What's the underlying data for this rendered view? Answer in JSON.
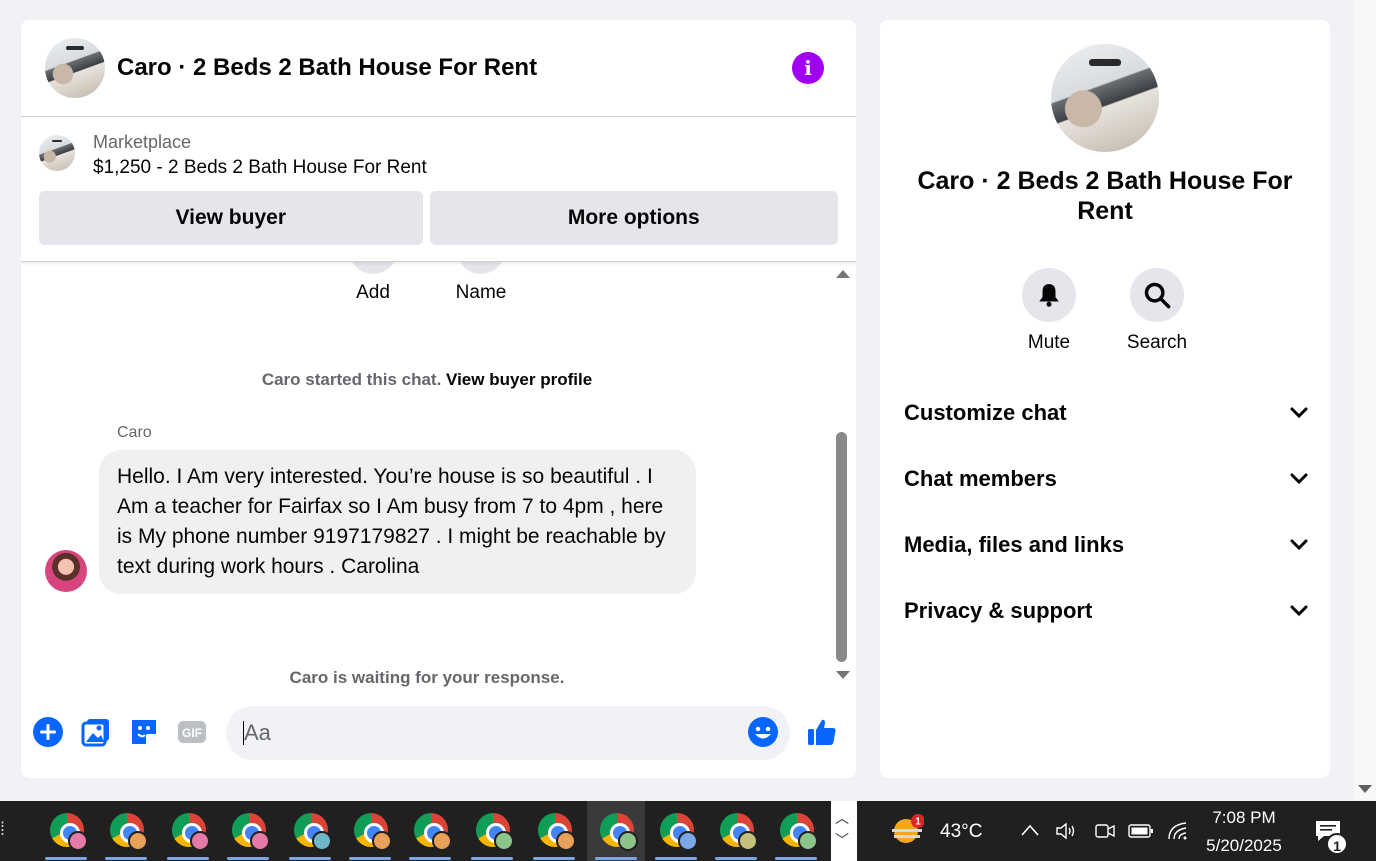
{
  "chat": {
    "title": "Caro · 2 Beds 2 Bath House For Rent",
    "listing": {
      "label": "Marketplace",
      "price_title": "$1,250 - 2 Beds 2 Bath House For Rent"
    },
    "buttons": {
      "view_buyer": "View buyer",
      "more_options": "More options"
    },
    "stub_actions": {
      "add": "Add",
      "name": "Name"
    },
    "started_text": "Caro started this chat.",
    "view_profile_link": "View buyer profile",
    "message": {
      "sender": "Caro",
      "text": "Hello. I Am very interested. You’re house is so beautiful . I Am a teacher for Fairfax so I Am busy from 7 to 4pm , here is My phone number 9197179827 . I might be reachable by text during work hours . Carolina"
    },
    "waiting_text": "Caro is waiting for your response.",
    "composer": {
      "placeholder": "Aa"
    }
  },
  "info": {
    "title": "Caro · 2 Beds 2 Bath House For Rent",
    "actions": {
      "mute": "Mute",
      "search": "Search"
    },
    "sections": [
      "Customize chat",
      "Chat members",
      "Media, files and links",
      "Privacy & support"
    ]
  },
  "taskbar": {
    "weather": {
      "temp": "43°C",
      "alert_count": "1"
    },
    "time": "7:08 PM",
    "date": "5/20/2025",
    "notification_count": "1"
  },
  "colors": {
    "messenger_blue": "#0866ff",
    "info_purple": "#a100f2",
    "taskbar_bg": "#202020"
  }
}
